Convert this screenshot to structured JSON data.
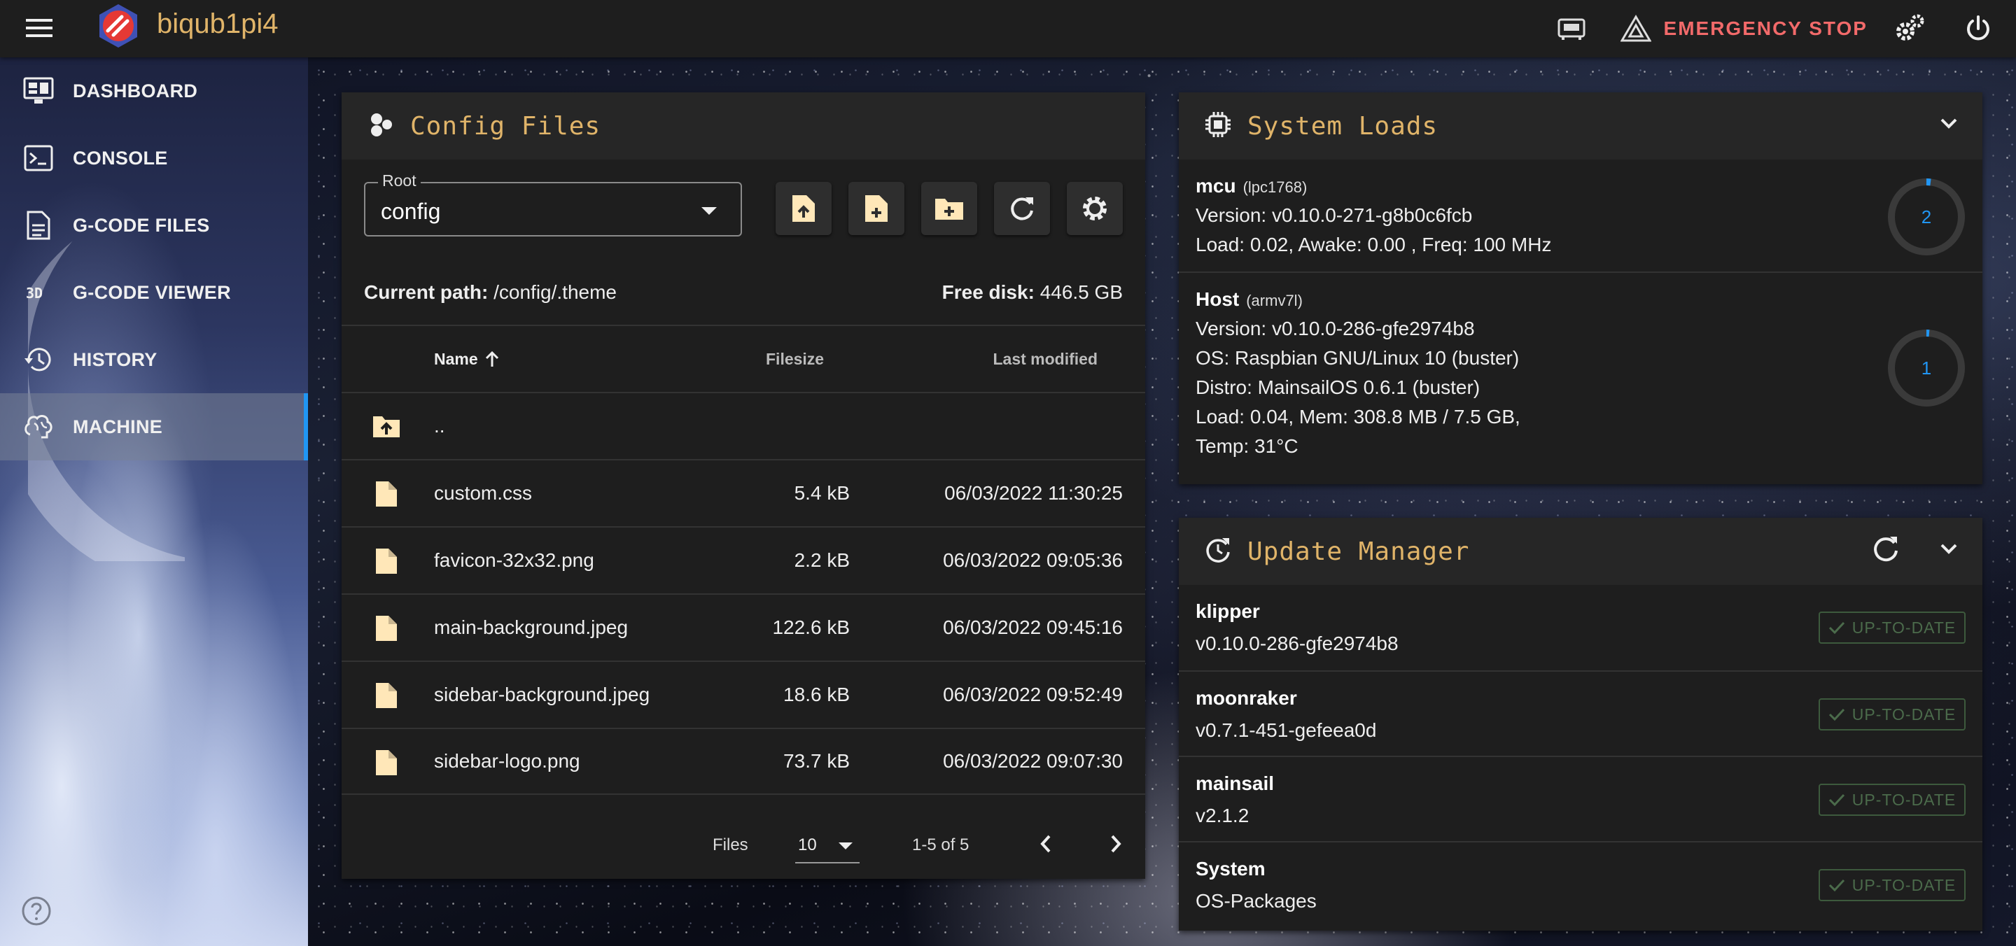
{
  "app": {
    "title": "biqub1pi4"
  },
  "appbar": {
    "emergency_stop_label": "EMERGENCY STOP"
  },
  "sidebar": {
    "items": [
      {
        "label": "DASHBOARD",
        "icon": "monitor-dashboard-icon"
      },
      {
        "label": "CONSOLE",
        "icon": "console-icon"
      },
      {
        "label": "G-CODE FILES",
        "icon": "file-document-icon"
      },
      {
        "label": "G-CODE VIEWER",
        "icon": "3d-viewer-icon"
      },
      {
        "label": "HISTORY",
        "icon": "history-icon"
      },
      {
        "label": "MACHINE",
        "icon": "brain-icon",
        "active": true
      }
    ]
  },
  "config_files": {
    "title": "Config Files",
    "root_label": "Root",
    "root_value": "config",
    "current_path_label": "Current path:",
    "current_path": "/config/.theme",
    "free_disk_label": "Free disk:",
    "free_disk": "446.5 GB",
    "columns": {
      "name": "Name",
      "size": "Filesize",
      "modified": "Last modified"
    },
    "parent_dir": "..",
    "files": [
      {
        "name": "custom.css",
        "size": "5.4 kB",
        "modified": "06/03/2022 11:30:25"
      },
      {
        "name": "favicon-32x32.png",
        "size": "2.2 kB",
        "modified": "06/03/2022 09:05:36"
      },
      {
        "name": "main-background.jpeg",
        "size": "122.6 kB",
        "modified": "06/03/2022 09:45:16"
      },
      {
        "name": "sidebar-background.jpeg",
        "size": "18.6 kB",
        "modified": "06/03/2022 09:52:49"
      },
      {
        "name": "sidebar-logo.png",
        "size": "73.7 kB",
        "modified": "06/03/2022 09:07:30"
      }
    ],
    "pager": {
      "label": "Files",
      "per_page": "10",
      "range": "1-5 of 5"
    }
  },
  "system_loads": {
    "title": "System Loads",
    "mcu": {
      "name": "mcu",
      "chip": "(lpc1768)",
      "version": "Version: v0.10.0-271-g8b0c6fcb",
      "load": "Load: 0.02, Awake: 0.00 , Freq: 100 MHz",
      "gauge_value": "2"
    },
    "host": {
      "name": "Host",
      "arch": "(armv7l)",
      "version": "Version: v0.10.0-286-gfe2974b8",
      "os": "OS: Raspbian GNU/Linux 10 (buster)",
      "distro": "Distro: MainsailOS 0.6.1 (buster)",
      "load": "Load: 0.04, Mem: 308.8 MB / 7.5 GB,",
      "temp": "Temp: 31°C",
      "gauge_value": "1"
    }
  },
  "update_manager": {
    "title": "Update Manager",
    "badge_label": "UP-TO-DATE",
    "items": [
      {
        "name": "klipper",
        "version": "v0.10.0-286-gfe2974b8"
      },
      {
        "name": "moonraker",
        "version": "v0.7.1-451-gefeea0d"
      },
      {
        "name": "mainsail",
        "version": "v2.1.2"
      },
      {
        "name": "System",
        "version": "OS-Packages"
      }
    ]
  },
  "colors": {
    "accent": "#e0b469",
    "estop": "#f26a6a",
    "primary": "#2196f3",
    "panel": "#1e1e1e",
    "success_dim": "#4b6b4b"
  }
}
